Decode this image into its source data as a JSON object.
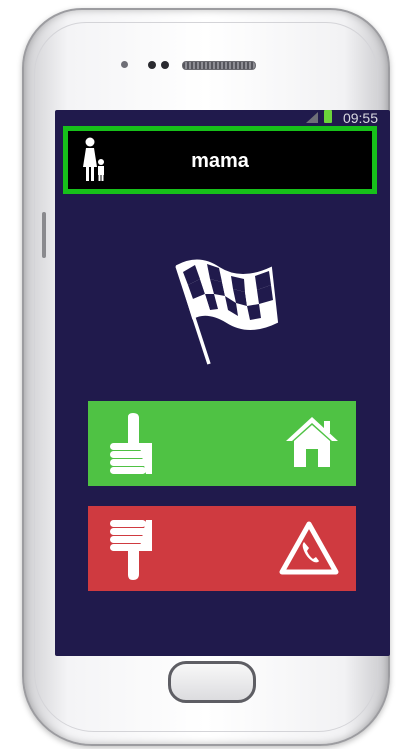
{
  "status": {
    "time": "09:55"
  },
  "header": {
    "title": "mama",
    "avatar_icon": "mother-child-icon"
  },
  "main": {
    "center_icon": "checkered-flag-icon",
    "yes_button": {
      "left_icon": "thumbs-up-icon",
      "right_icon": "home-icon",
      "color": "#4fc244"
    },
    "no_button": {
      "left_icon": "thumbs-down-icon",
      "right_icon": "emergency-call-icon",
      "color": "#cf3a40"
    }
  },
  "colors": {
    "screen_bg": "#201a4c",
    "header_border": "#17c01a"
  }
}
